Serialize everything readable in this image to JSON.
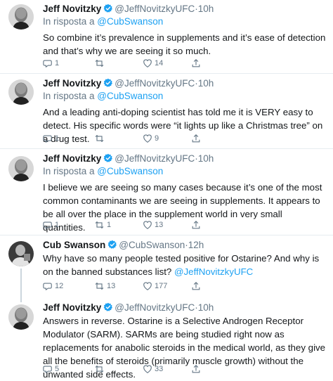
{
  "colors": {
    "accent": "#1da1f2",
    "muted": "#657786",
    "text": "#14171a",
    "divider": "#e6ecf0"
  },
  "tweets": [
    {
      "name": "Jeff Novitzky",
      "handle": "@JeffNovitzkyUFC",
      "dot": "·",
      "time": "10h",
      "reply_prefix": "In risposta a ",
      "reply_to": "@CubSwanson",
      "text": "So combine it’s prevalence in supplements and it’s ease of detection and that’s why we are seeing it so much.",
      "replies": "1",
      "retweets": "",
      "likes": "14"
    },
    {
      "name": "Jeff Novitzky",
      "handle": "@JeffNovitzkyUFC",
      "dot": "·",
      "time": "10h",
      "reply_prefix": "In risposta a ",
      "reply_to": "@CubSwanson",
      "text": "And a leading anti-doping scientist has told me it is VERY easy to detect. His specific words were “it lights up like a Christmas tree” on a drug test.",
      "replies": "1",
      "retweets": "",
      "likes": "9"
    },
    {
      "name": "Jeff Novitzky",
      "handle": "@JeffNovitzkyUFC",
      "dot": "·",
      "time": "10h",
      "reply_prefix": "In risposta a ",
      "reply_to": "@CubSwanson",
      "text": "I believe we are seeing so many cases because it’s one of the most common contaminants we are seeing in supplements.  It appears to be all over the place in the supplement world in very small quantities.",
      "replies": "1",
      "retweets": "1",
      "likes": "13"
    },
    {
      "name": "Cub Swanson",
      "handle": "@CubSwanson",
      "dot": "·",
      "time": "12h",
      "text_main": "Why have so many people tested positive for Ostarine? And why is on the banned substances list? ",
      "text_mention": "@JeffNovitzkyUFC",
      "replies": "12",
      "retweets": "13",
      "likes": "177"
    },
    {
      "name": "Jeff Novitzky",
      "handle": "@JeffNovitzkyUFC",
      "dot": "·",
      "time": "10h",
      "text": "Answers in reverse.  Ostarine is a Selective Androgen Receptor Modulator (SARM). SARMs are being studied right now as replacements for anabolic steroids in the medical world, as they give all the benefits of steroids (primarily muscle growth) without the unwanted side effects.",
      "replies": "5",
      "retweets": "",
      "likes": "33"
    }
  ],
  "icons": {
    "reply": "reply-icon",
    "retweet": "retweet-icon",
    "like": "heart-icon",
    "share": "share-icon",
    "verified": "verified-badge-icon"
  }
}
